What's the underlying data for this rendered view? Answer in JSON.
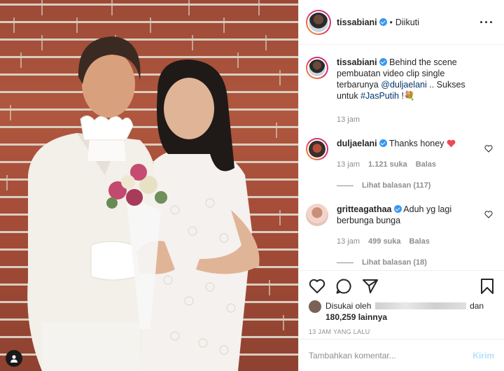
{
  "header": {
    "username": "tissabiani",
    "separator": "•",
    "follow_status": "Diikuti",
    "more": "···"
  },
  "caption": {
    "username": "tissabiani",
    "text_1": "Behind the scene pembuatan video clip single terbarunya",
    "mention": "@duljaelani",
    "text_2": ".. Sukses untuk",
    "hashtag": "#JasPutih",
    "text_3": "!",
    "emoji": "💐",
    "time": "13 jam"
  },
  "comments": [
    {
      "username": "duljaelani",
      "text": "Thanks honey",
      "time": "13 jam",
      "likes": "1.121 suka",
      "reply": "Balas",
      "view_replies": "Lihat balasan (117)"
    },
    {
      "username": "gritteagathaa",
      "text": "Aduh yg lagi berbunga bunga",
      "time": "13 jam",
      "likes": "499 suka",
      "reply": "Balas",
      "view_replies": "Lihat balasan (18)"
    }
  ],
  "likes": {
    "prefix": "Disukai oleh",
    "suffix": "dan",
    "count": "180,259 lainnya"
  },
  "timestamp": "13 JAM YANG LALU",
  "add_comment": {
    "placeholder": "Tambahkan komentar...",
    "post": "Kirim"
  },
  "colors": {
    "verified": "#3897f0",
    "heart": "#ed4956",
    "link": "#00376b"
  }
}
